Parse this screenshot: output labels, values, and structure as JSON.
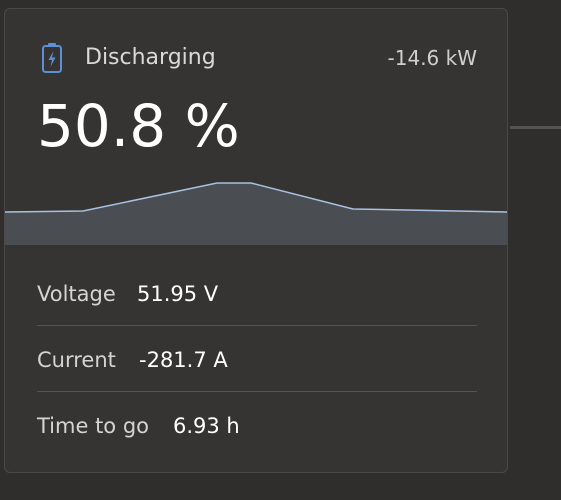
{
  "battery": {
    "icon": "battery-charging-icon",
    "status": "Discharging",
    "power": "-14.6 kW",
    "state_of_charge": "50.8 %"
  },
  "details": [
    {
      "label": "Voltage",
      "value": "51.95 V"
    },
    {
      "label": "Current",
      "value": "-281.7 A"
    },
    {
      "label": "Time to go",
      "value": "6.93 h"
    }
  ],
  "colors": {
    "background": "#2f2e2c",
    "card": "#353433",
    "graph_fill": "#4a4d52",
    "graph_line": "#a9c1e0",
    "icon_accent": "#5b8fd6"
  }
}
